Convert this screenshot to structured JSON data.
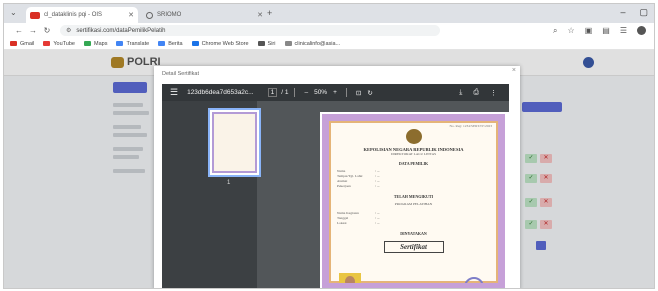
{
  "browser": {
    "tabs": [
      {
        "label": "cl_dataklinis pqi - OIS",
        "active": true
      },
      {
        "label": "SRIOMO",
        "active": false
      }
    ],
    "url": "sertifikasi.com/dataPemilikPelatih",
    "bookmarks": [
      {
        "label": "Gmail",
        "color": "#d93025"
      },
      {
        "label": "YouTube",
        "color": "#e53935"
      },
      {
        "label": "Maps",
        "color": "#34a853"
      },
      {
        "label": "Translate",
        "color": "#4285f4"
      },
      {
        "label": "Berita",
        "color": "#4285f4"
      },
      {
        "label": "Chrome Web Store",
        "color": "#1a73e8"
      },
      {
        "label": "Siri",
        "color": "#555555"
      },
      {
        "label": "clinicalinfo@asia...",
        "color": "#888888"
      }
    ]
  },
  "page": {
    "logo_text": "POLRI"
  },
  "modal": {
    "title": "Detail Sertifikat",
    "close": "×",
    "viewer": {
      "filename": "123db6dea7d653a2c...",
      "page_current": "1",
      "page_total": "/ 1",
      "zoom": "50%",
      "thumb_label": "1"
    },
    "certificate": {
      "number": "No. Reg: 1234/SERT/IV/2023",
      "heading": "KEPOLISIAN NEGARA REPUBLIK INDONESIA",
      "subheading": "DIREKTORAT LALU LINTAS",
      "section1": "DATA PEMILIK",
      "fields1": [
        {
          "k": "Nama",
          "v": ": ..."
        },
        {
          "k": "Tempat/Tgl. Lahir",
          "v": ": ..."
        },
        {
          "k": "Alamat",
          "v": ": ..."
        },
        {
          "k": "Pekerjaan",
          "v": ": ..."
        }
      ],
      "section2": "TELAH MENGIKUTI",
      "section2_sub": "PROGRAM PELATIHAN",
      "fields2": [
        {
          "k": "Nama Kegiatan",
          "v": ": ..."
        },
        {
          "k": "Tanggal",
          "v": ": ..."
        },
        {
          "k": "Lokasi",
          "v": ": ..."
        }
      ],
      "section3": "DINYATAKAN",
      "title_text": "Sertifikat"
    }
  }
}
